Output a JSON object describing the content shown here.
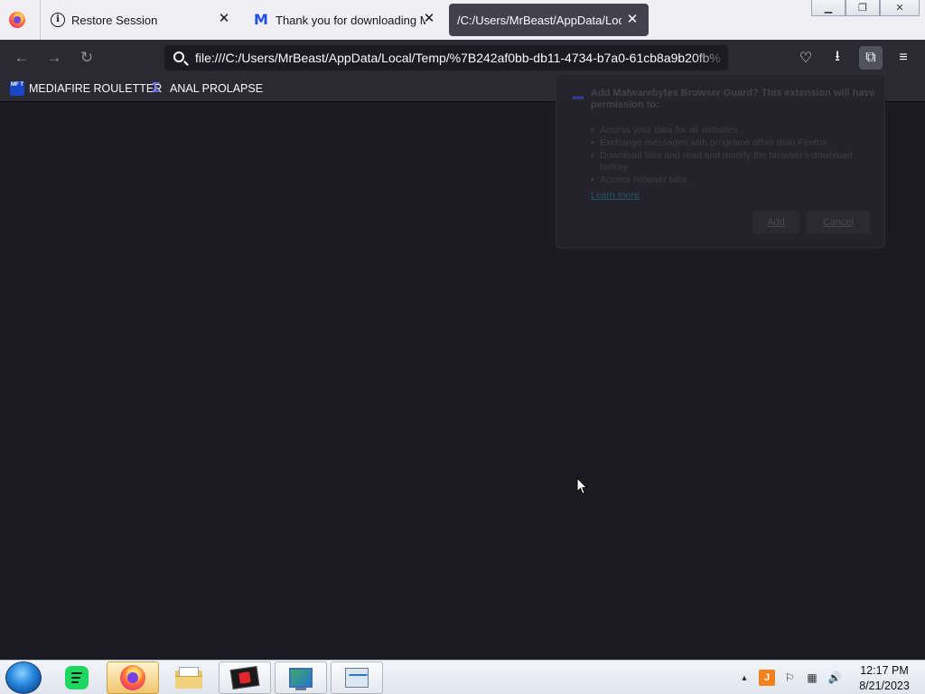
{
  "browser": {
    "tabs": [
      {
        "title": "Restore Session",
        "icon": "info-icon",
        "active": false
      },
      {
        "title": "Thank you for downloading Ma",
        "icon": "malwarebytes-icon",
        "active": false
      },
      {
        "title": "/C:/Users/MrBeast/AppData/Local/",
        "icon": "none",
        "active": true
      }
    ],
    "tab_close_glyph": "✕",
    "window_controls": {
      "minimize": "▁",
      "maximize": "❐",
      "close": "✕"
    },
    "toolbar": {
      "back": "←",
      "forward": "→",
      "reload": "↻",
      "url": "file:///C:/Users/MrBeast/AppData/Local/Temp/%7B242af0bb-db11-4734-b7a0-61cb8a9b20fb%",
      "pocket": "♡",
      "downloads": "⭳",
      "extensions": "⧉",
      "menu": "≡"
    },
    "bookmarks": [
      {
        "label": "MEDIAFIRE ROULETTER",
        "favicon_text": "MF T"
      },
      {
        "label": "ANAL PROLAPSE",
        "favicon_text": "Σ"
      }
    ]
  },
  "extension_prompt": {
    "heading": "Add Malwarebytes Browser Guard? This extension will have permission to:",
    "permissions": [
      "Access your data for all websites",
      "Exchange messages with programs other than Firefox",
      "Download files and read and modify the browser's download history",
      "Access browser tabs"
    ],
    "learn_more": "Learn more",
    "add_label": "Add",
    "cancel_label": "Cancel"
  },
  "taskbar": {
    "items": [
      "spotify-icon",
      "firefox-icon",
      "file-explorer-icon",
      "graphics-card-icon",
      "display-settings-icon",
      "resource-monitor-icon"
    ],
    "tray": {
      "show_hidden": "▲",
      "java": "J",
      "flag": "⚐",
      "network": "▦",
      "volume": "🔊"
    },
    "time": "12:17 PM",
    "date": "8/21/2023"
  },
  "colors": {
    "content_bg": "#1c1b22",
    "toolbar_bg": "#2b2a33",
    "tabstrip_bg": "#f0f0f4",
    "active_tab_bg": "#42414d"
  }
}
